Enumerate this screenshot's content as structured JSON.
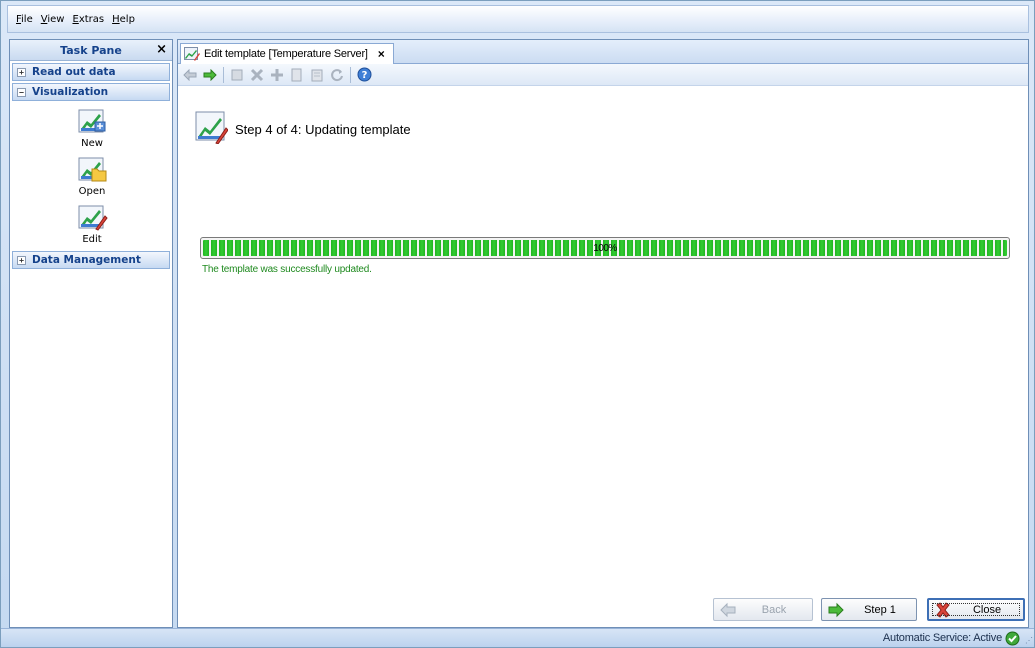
{
  "menu": {
    "items": [
      {
        "accel": "F",
        "rest": "ile"
      },
      {
        "accel": "V",
        "rest": "iew"
      },
      {
        "accel": "E",
        "rest": "xtras"
      },
      {
        "accel": "H",
        "rest": "elp"
      }
    ]
  },
  "task_pane": {
    "title": "Task Pane",
    "close": "×",
    "sections": [
      {
        "toggle": "+",
        "label": "Read out data"
      },
      {
        "toggle": "−",
        "label": "Visualization"
      },
      {
        "toggle": "+",
        "label": "Data Management"
      }
    ],
    "tools": [
      {
        "label": "New",
        "icon": "chart-new-icon"
      },
      {
        "label": "Open",
        "icon": "chart-open-icon"
      },
      {
        "label": "Edit",
        "icon": "chart-edit-icon"
      }
    ]
  },
  "document": {
    "tab": {
      "title": "Edit template [Temperature Server]",
      "close": "×"
    },
    "toolbar_icons": [
      "back-arrow-icon",
      "forward-arrow-icon",
      "properties-icon",
      "delete-icon",
      "add-icon",
      "copy-icon",
      "paste-icon",
      "refresh-icon",
      "help-icon"
    ],
    "step_title": "Step 4 of 4: Updating template",
    "progress": {
      "value": 1.0,
      "label": "100%"
    },
    "status_message": "The template was successfully updated.",
    "buttons": {
      "back": "Back",
      "step1": "Step 1",
      "close": "Close"
    }
  },
  "statusbar": {
    "text": "Automatic Service: Active",
    "icon": "check-icon"
  },
  "colors": {
    "accent": "#15428b",
    "progress": "#22b422",
    "success_text": "#1f8a1f"
  }
}
